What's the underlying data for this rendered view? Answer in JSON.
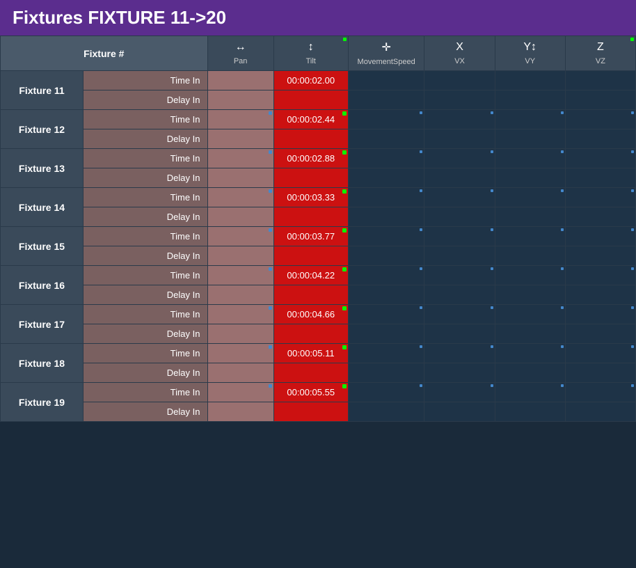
{
  "title": "Fixtures FIXTURE 11->20",
  "columns": {
    "fixture_header": "Fixture #",
    "pan": "Pan",
    "tilt": "Tilt",
    "movespeed": "MovementSpeed",
    "vx": "VX",
    "vy": "VY",
    "vz": "VZ"
  },
  "fixtures": [
    {
      "id": "fixture-11",
      "label": "Fixture 11",
      "time_in_label": "Time In",
      "delay_in_label": "Delay In",
      "tilt_time": "00:00:02.00"
    },
    {
      "id": "fixture-12",
      "label": "Fixture 12",
      "time_in_label": "Time In",
      "delay_in_label": "Delay In",
      "tilt_time": "00:00:02.44"
    },
    {
      "id": "fixture-13",
      "label": "Fixture 13",
      "time_in_label": "Time In",
      "delay_in_label": "Delay In",
      "tilt_time": "00:00:02.88"
    },
    {
      "id": "fixture-14",
      "label": "Fixture 14",
      "time_in_label": "Time In",
      "delay_in_label": "Delay In",
      "tilt_time": "00:00:03.33"
    },
    {
      "id": "fixture-15",
      "label": "Fixture 15",
      "time_in_label": "Time In",
      "delay_in_label": "Delay In",
      "tilt_time": "00:00:03.77"
    },
    {
      "id": "fixture-16",
      "label": "Fixture 16",
      "time_in_label": "Time In",
      "delay_in_label": "Delay In",
      "tilt_time": "00:00:04.22"
    },
    {
      "id": "fixture-17",
      "label": "Fixture 17",
      "time_in_label": "Time In",
      "delay_in_label": "Delay In",
      "tilt_time": "00:00:04.66"
    },
    {
      "id": "fixture-18",
      "label": "Fixture 18",
      "time_in_label": "Time In",
      "delay_in_label": "Delay In",
      "tilt_time": "00:00:05.11"
    },
    {
      "id": "fixture-19",
      "label": "Fixture 19",
      "time_in_label": "Time In",
      "delay_in_label": "Delay In",
      "tilt_time": "00:00:05.55"
    }
  ]
}
